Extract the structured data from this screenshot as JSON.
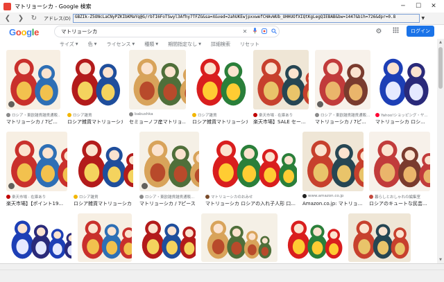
{
  "window": {
    "title": "マトリョーシカ - Google 検索"
  },
  "nav": {
    "address_label": "アドレス(D)",
    "address_value": "GBZIk-Z5ONcLaCNyPZKIbKMaYq@G/rbTI6FoTSwyl3Afhy7TFZG&sa=X&ved=2ahUKEwjpxxwefCHAvWUb_UHHUOfXIQtKgLegQIEBAB&bw=1447&bih=726&dpr=0.8"
  },
  "header": {
    "logo": [
      "G",
      "o",
      "o",
      "g",
      "l",
      "e"
    ],
    "query": "マトリョーシカ",
    "login": "ログイン"
  },
  "filters": [
    "サイズ",
    "色",
    "ライセンス",
    "種類",
    "期間指定なし",
    "詳細検索",
    "リセット"
  ],
  "results": [
    {
      "source": "ロシア・東欧雑貨雑貨通販...",
      "caption": "マトリョーシカ / 7ピ...",
      "fav": "#8a8a8a"
    },
    {
      "source": "ロシア雑貨",
      "caption": "ロシア雑貨マトリョーシカ...",
      "fav": "#f2b600"
    },
    {
      "source": "babushka",
      "caption": "セミョーノフ産マトリョ...",
      "fav": "#888888"
    },
    {
      "source": "ロシア雑貨",
      "caption": "ロシア雑貨マトリョーシカ...",
      "fav": "#f2b600"
    },
    {
      "source": "楽天市場 · 在庫あり",
      "caption": "楽天市場】SALE セー...",
      "fav": "#bf0000"
    },
    {
      "source": "ロシア・東欧雑貨雑貨通販...",
      "caption": "マトリョーシカ / 7ピ...",
      "fav": "#8a8a8a"
    },
    {
      "source": "Yahoo!ショッピング・ヤ...",
      "caption": "マトリョーシカ ロシ...",
      "fav": "#ff0033"
    },
    {
      "source": "楽天市場 · 在庫あり",
      "caption": "楽天市場】【ポイント19...",
      "fav": "#bf0000"
    },
    {
      "source": "ロシア雑貨",
      "caption": "ロシア雑貨マトリョーシカ /...",
      "fav": "#f2b600"
    },
    {
      "source": "ロシア・東欧雑貨雑貨通販...",
      "caption": "マトリョーシカ / 7ピース",
      "fav": "#8a8a8a"
    },
    {
      "source": "マトリョーシカのおみせ",
      "caption": "マトリョーシカ ロシアの入れ子人形 口...",
      "fav": "#7a4b2a"
    },
    {
      "source": "www.amazon.co.jp",
      "caption": "Amazon.co.jp: マトリョ...",
      "fav": "#222222"
    },
    {
      "source": "暮らしとおしゃれの編集室",
      "caption": "ロシアのキュートな民芸...",
      "fav": "#c4483c"
    },
    {
      "source": "",
      "caption": "",
      "fav": "#cccccc"
    },
    {
      "source": "",
      "caption": "",
      "fav": "#cccccc"
    },
    {
      "source": "",
      "caption": "",
      "fav": "#cccccc"
    },
    {
      "source": "",
      "caption": "",
      "fav": "#cccccc"
    },
    {
      "source": "",
      "caption": "",
      "fav": "#cccccc"
    },
    {
      "source": "",
      "caption": "",
      "fav": "#cccccc"
    }
  ],
  "colors": {
    "accent": "#1a73e8",
    "title_icon": "#e94235"
  }
}
